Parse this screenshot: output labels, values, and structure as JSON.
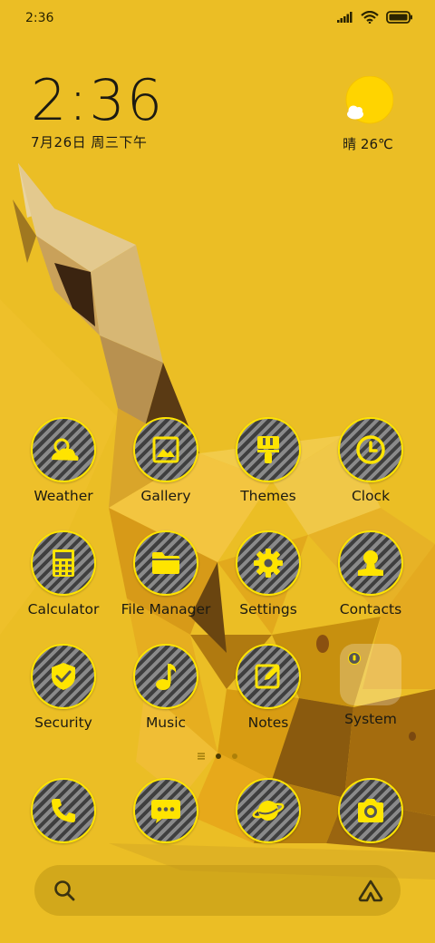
{
  "status_bar": {
    "time": "2:36",
    "icons": [
      "signal-icon",
      "wifi-icon",
      "battery-icon"
    ]
  },
  "clock_widget": {
    "time": "2:36",
    "date": "7月26日 周三下午"
  },
  "weather_widget": {
    "text": "晴 26℃",
    "icon": "sunny-cloud-icon"
  },
  "apps": [
    {
      "label": "Weather",
      "icon": "weather-icon"
    },
    {
      "label": "Gallery",
      "icon": "gallery-icon"
    },
    {
      "label": "Themes",
      "icon": "themes-icon"
    },
    {
      "label": "Clock",
      "icon": "clock-icon"
    },
    {
      "label": "Calculator",
      "icon": "calculator-icon"
    },
    {
      "label": "File Manager",
      "icon": "folder-icon"
    },
    {
      "label": "Settings",
      "icon": "gear-icon"
    },
    {
      "label": "Contacts",
      "icon": "contacts-icon"
    },
    {
      "label": "Security",
      "icon": "shield-icon"
    },
    {
      "label": "Music",
      "icon": "music-note-icon"
    },
    {
      "label": "Notes",
      "icon": "notes-icon"
    },
    {
      "label": "System",
      "icon": "folder-icon"
    }
  ],
  "page_indicator": {
    "pages": 2,
    "current": 1
  },
  "dock": [
    {
      "icon": "phone-icon"
    },
    {
      "icon": "messages-icon"
    },
    {
      "icon": "browser-planet-icon"
    },
    {
      "icon": "camera-icon"
    }
  ],
  "search_bar": {
    "icons": [
      "search-icon",
      "assistant-icon"
    ]
  },
  "colors": {
    "background": "#EBBE25",
    "accent": "#FFE400",
    "text": "#1c1a12"
  }
}
